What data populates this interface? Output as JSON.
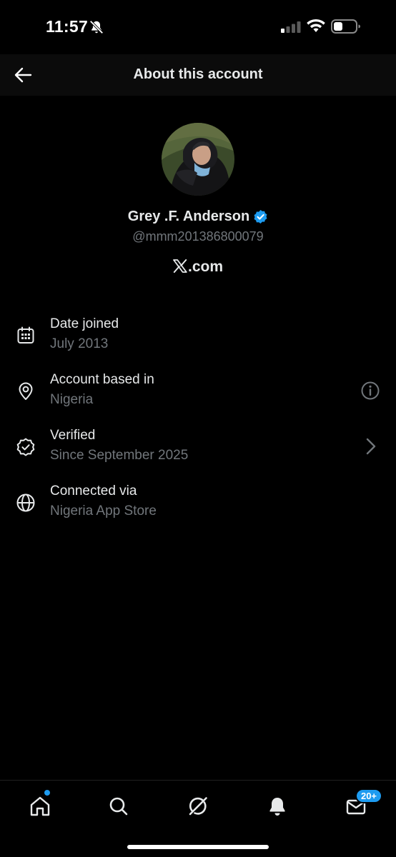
{
  "status_bar": {
    "time": "11:57",
    "icons": [
      "bell-off-icon",
      "signal-icon",
      "wifi-icon",
      "battery-icon"
    ]
  },
  "header": {
    "back_icon": "arrow-left-icon",
    "title": "About this account"
  },
  "profile": {
    "name": "Grey .F. Anderson",
    "verified": true,
    "handle": "@mmm201386800079",
    "site_suffix": ".com",
    "site_logo": "x-logo-icon"
  },
  "info_items": [
    {
      "icon": "calendar-icon",
      "label": "Date joined",
      "value": "July 2013"
    },
    {
      "icon": "location-pin-icon",
      "label": "Account based in",
      "value": "Nigeria",
      "action_icon": "info-circle-icon"
    },
    {
      "icon": "verified-badge-outline-icon",
      "label": "Verified",
      "value": "Since September 2025",
      "action_icon": "chevron-right-icon"
    },
    {
      "icon": "globe-icon",
      "label": "Connected via",
      "value": "Nigeria App Store"
    }
  ],
  "bottom_nav": {
    "items": [
      "home-icon",
      "search-icon",
      "grok-icon",
      "notifications-icon",
      "messages-icon"
    ],
    "messages_badge": "20+"
  },
  "colors": {
    "background": "#000000",
    "header_background": "#0b0b0b",
    "text_primary": "#e7e9ea",
    "text_secondary": "#71767b",
    "accent": "#1d9bf0"
  }
}
